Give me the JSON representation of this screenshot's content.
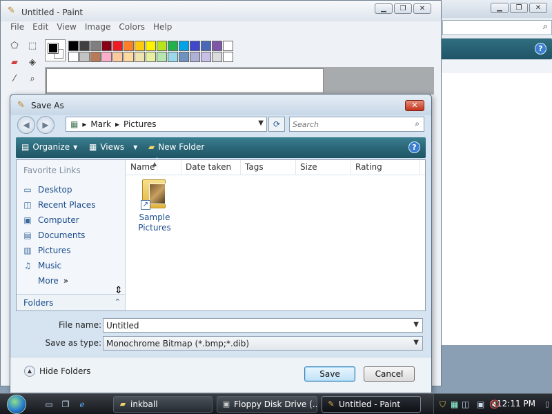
{
  "background_window": {
    "help_icon": "?"
  },
  "paint": {
    "title": "Untitled - Paint",
    "menu": [
      "File",
      "Edit",
      "View",
      "Image",
      "Colors",
      "Help"
    ],
    "palette_colors": [
      "#000000",
      "#404040",
      "#7f7f7f",
      "#880015",
      "#ed1c24",
      "#ff7f27",
      "#ffc90e",
      "#fff200",
      "#b5e61d",
      "#22b14c",
      "#00a2e8",
      "#3f48cc",
      "#4a68b8",
      "#7e57a8",
      "#ffffff",
      "#ffffff",
      "#c3c3c3",
      "#b97a57",
      "#ffaec9",
      "#ffc9a0",
      "#ffd9a0",
      "#efe4b0",
      "#e6f0a0",
      "#b5e6b0",
      "#99d9ea",
      "#7092be",
      "#b0b0d6",
      "#c8bfe7",
      "#dcdcdc",
      "#ffffff"
    ]
  },
  "dialog": {
    "title": "Save As",
    "breadcrumb": [
      "Mark",
      "Pictures"
    ],
    "search_placeholder": "Search",
    "commands": {
      "organize": "Organize",
      "views": "Views",
      "new_folder": "New Folder"
    },
    "nav_header": "Favorite Links",
    "links": [
      {
        "label": "Desktop",
        "icon": "desktop-icon"
      },
      {
        "label": "Recent Places",
        "icon": "recent-places-icon"
      },
      {
        "label": "Computer",
        "icon": "computer-icon"
      },
      {
        "label": "Documents",
        "icon": "documents-icon"
      },
      {
        "label": "Pictures",
        "icon": "pictures-icon"
      },
      {
        "label": "Music",
        "icon": "music-icon"
      }
    ],
    "more_label": "More",
    "folders_label": "Folders",
    "columns": [
      "Name",
      "Date taken",
      "Tags",
      "Size",
      "Rating"
    ],
    "items": [
      {
        "line1": "Sample",
        "line2": "Pictures"
      }
    ],
    "file_name_label": "File name:",
    "file_name_value": "Untitled",
    "save_type_label": "Save as type:",
    "save_type_value": "Monochrome Bitmap (*.bmp;*.dib)",
    "hide_folders": "Hide Folders",
    "save_button": "Save",
    "cancel_button": "Cancel"
  },
  "taskbar": {
    "buttons": [
      {
        "label": "inkball"
      },
      {
        "label": "Floppy Disk Drive (..."
      },
      {
        "label": "Untitled - Paint"
      }
    ],
    "clock": "12:11 PM"
  }
}
